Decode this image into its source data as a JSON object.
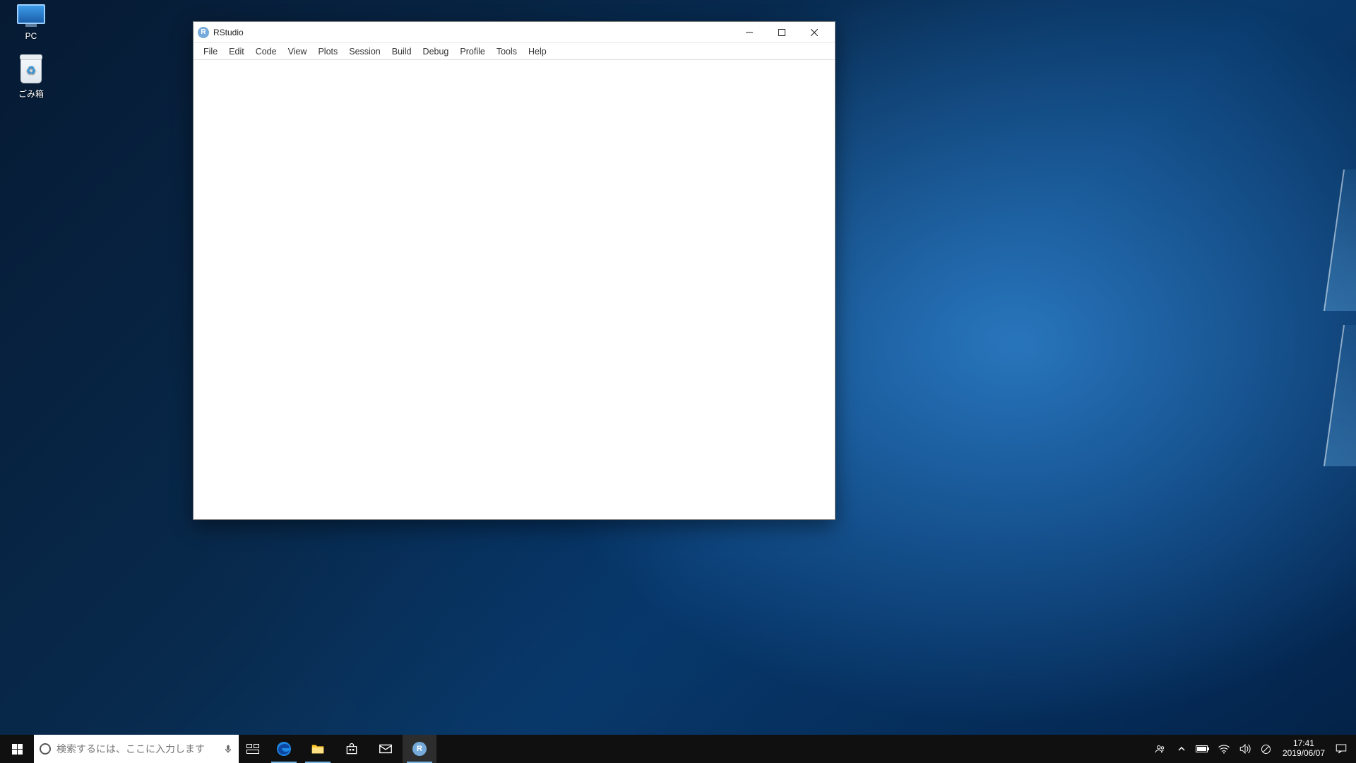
{
  "desktop_icons": {
    "pc": {
      "label": "PC"
    },
    "recycle": {
      "label": "ごみ箱"
    }
  },
  "taskbar": {
    "search_placeholder": "検索するには、ここに入力します",
    "clock_time": "17:41",
    "clock_date": "2019/06/07"
  },
  "window": {
    "title": "RStudio",
    "app_icon_letter": "R",
    "menu": {
      "file": "File",
      "edit": "Edit",
      "code": "Code",
      "view": "View",
      "plots": "Plots",
      "session": "Session",
      "build": "Build",
      "debug": "Debug",
      "profile": "Profile",
      "tools": "Tools",
      "help": "Help"
    }
  }
}
